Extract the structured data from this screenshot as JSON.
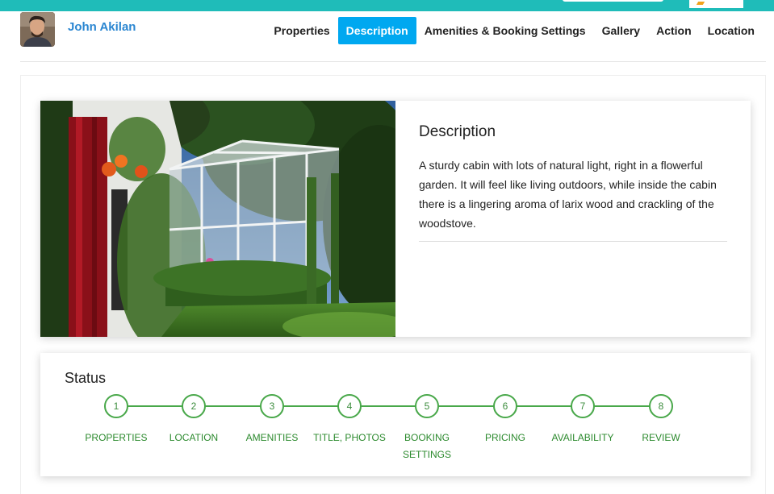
{
  "user": {
    "name": "John Akilan"
  },
  "nav": {
    "items": [
      {
        "label": "Properties",
        "active": false
      },
      {
        "label": "Description",
        "active": true
      },
      {
        "label": "Amenities & Booking Settings",
        "active": false
      },
      {
        "label": "Gallery",
        "active": false
      },
      {
        "label": "Action",
        "active": false
      },
      {
        "label": "Location",
        "active": false
      }
    ]
  },
  "description": {
    "title": "Description",
    "text": "A sturdy cabin with lots of natural light, right in a flowerful garden. It will feel like living outdoors, while inside the cabin there is a lingering aroma of larix wood and crackling of the woodstove."
  },
  "status": {
    "title": "Status",
    "steps": [
      {
        "number": "1",
        "label": "PROPERTIES"
      },
      {
        "number": "2",
        "label": "LOCATION"
      },
      {
        "number": "3",
        "label": "AMENITIES"
      },
      {
        "number": "4",
        "label": "TITLE, PHOTOS"
      },
      {
        "number": "5",
        "label": "BOOKING SETTINGS"
      },
      {
        "number": "6",
        "label": "PRICING"
      },
      {
        "number": "7",
        "label": "AVAILABILITY"
      },
      {
        "number": "8",
        "label": "REVIEW"
      }
    ]
  },
  "colors": {
    "accent": "#00a8f0",
    "topbar": "#1fbcb9",
    "step_green": "#49a84a",
    "username": "#2a86d1"
  }
}
